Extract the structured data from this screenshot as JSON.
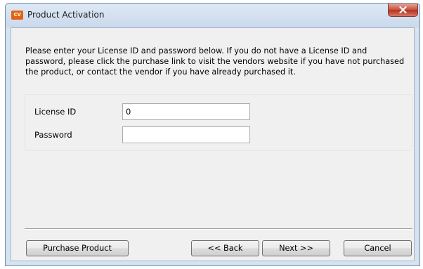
{
  "window": {
    "title": "Product Activation",
    "app_icon_text": "cv",
    "close_glyph": "✕"
  },
  "instructions": "Please enter your License ID and password below. If you do not have a License ID and password, please click the purchase link to visit the vendors website if you have not purchased the product, or contact the vendor if you have already purchased it.",
  "form": {
    "license_id_label": "License ID",
    "license_id_value": "0",
    "password_label": "Password",
    "password_value": ""
  },
  "buttons": {
    "purchase": "Purchase Product",
    "back": "<< Back",
    "next": "Next >>",
    "cancel": "Cancel"
  },
  "colors": {
    "title_bar": "#c9d9ec",
    "client_background": "#f0f0f0",
    "close_button": "#c8503d",
    "app_icon": "#e2611a"
  },
  "icons": {
    "app": "cv-app-icon",
    "close": "close-icon"
  }
}
